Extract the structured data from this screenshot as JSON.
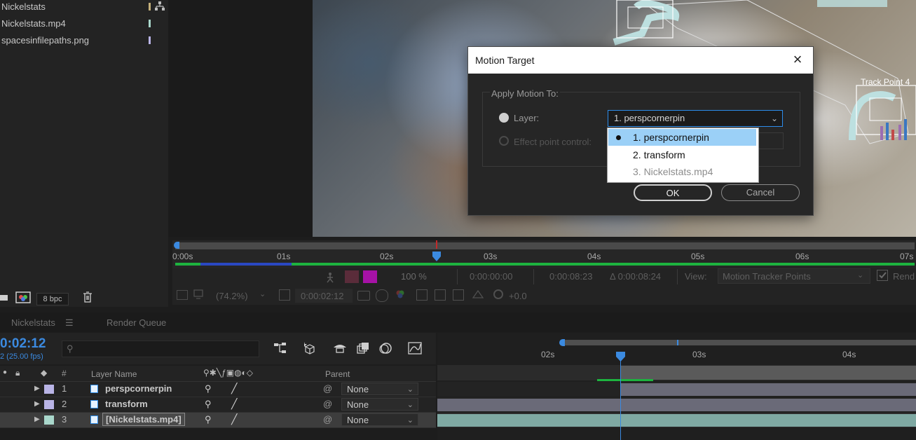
{
  "project": {
    "items": [
      {
        "label": "Nickelstats",
        "color": "#c4b07a"
      },
      {
        "label": "Nickelstats.mp4",
        "color": "#a9d7cb"
      },
      {
        "label": "spacesinfilepaths.png",
        "color": "#b9b4e6"
      }
    ],
    "bpc": "8 bpc"
  },
  "viewer_ruler": {
    "ticks": [
      "0:00s",
      "01s",
      "02s",
      "03s",
      "04s",
      "05s",
      "06s",
      "07s"
    ]
  },
  "viewer_controls": {
    "zoom_pct": "100 %",
    "time_start": "0:00:00:00",
    "time_end": "0:00:08:23",
    "time_delta": "Δ 0:00:08:24",
    "view_label": "View:",
    "view_value": "Motion Tracker Points",
    "render_label": "Rend",
    "magnification": "(74.2%)",
    "current_time": "0:00:02:12",
    "exposure": "+0.0"
  },
  "timeline": {
    "tabs": [
      "Nickelstats",
      "Render Queue"
    ],
    "current_time": "0:02:12",
    "fps": "2 (25.00 fps)",
    "columns": {
      "num": "#",
      "layer_name": "Layer Name",
      "parent": "Parent"
    },
    "ruler_ticks": [
      "02s",
      "03s",
      "04s"
    ],
    "layers": [
      {
        "num": "1",
        "name": "perspcornerpin",
        "parent": "None",
        "swatch": "#b9b4e6"
      },
      {
        "num": "2",
        "name": "transform",
        "parent": "None",
        "swatch": "#b9b4e6"
      },
      {
        "num": "3",
        "name": "[Nickelstats.mp4]",
        "parent": "None",
        "swatch": "#a9d7cb"
      }
    ]
  },
  "dialog": {
    "title": "Motion Target",
    "group_label": "Apply Motion To:",
    "layer_label": "Layer:",
    "effect_label": "Effect point control:",
    "layer_value": "1. perspcornerpin",
    "options": [
      {
        "label": "1. perspcornerpin",
        "selected": true,
        "enabled": true
      },
      {
        "label": "2. transform",
        "selected": false,
        "enabled": true
      },
      {
        "label": "3. Nickelstats.mp4",
        "selected": false,
        "enabled": false
      }
    ],
    "ok": "OK",
    "cancel": "Cancel"
  },
  "overlay": {
    "track_point_label": "Track Point 4"
  },
  "colors": {
    "accent_blue": "#2d8ceb",
    "playhead_blue": "#3b8ae0",
    "green_bar": "#1db33f"
  }
}
